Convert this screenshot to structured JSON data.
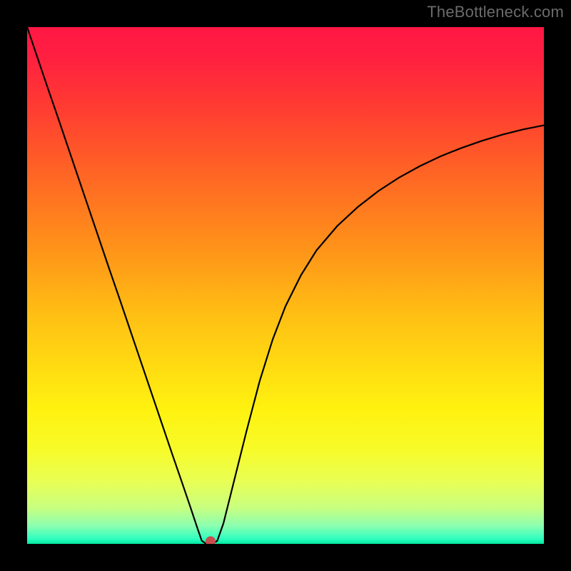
{
  "attribution": "TheBottleneck.com",
  "chart_data": {
    "type": "line",
    "title": "",
    "xlabel": "",
    "ylabel": "",
    "xlim": [
      0,
      100
    ],
    "ylim": [
      0,
      100
    ],
    "grid": false,
    "marker": {
      "x": 35.5,
      "y": 0.5,
      "color": "#c94d4d"
    },
    "gradient_stops": [
      {
        "offset": 0.0,
        "color": "#ff1744"
      },
      {
        "offset": 0.06,
        "color": "#ff2040"
      },
      {
        "offset": 0.15,
        "color": "#ff3a32"
      },
      {
        "offset": 0.25,
        "color": "#ff5a28"
      },
      {
        "offset": 0.35,
        "color": "#ff7a1f"
      },
      {
        "offset": 0.45,
        "color": "#ff9a18"
      },
      {
        "offset": 0.55,
        "color": "#ffbd14"
      },
      {
        "offset": 0.65,
        "color": "#ffd912"
      },
      {
        "offset": 0.74,
        "color": "#fff210"
      },
      {
        "offset": 0.82,
        "color": "#f7fb2a"
      },
      {
        "offset": 0.88,
        "color": "#e8ff55"
      },
      {
        "offset": 0.93,
        "color": "#c8ff80"
      },
      {
        "offset": 0.965,
        "color": "#8cffb0"
      },
      {
        "offset": 0.99,
        "color": "#30ffc0"
      },
      {
        "offset": 1.0,
        "color": "#00e6a0"
      }
    ],
    "series": [
      {
        "name": "bottleneck-curve",
        "x": [
          0.0,
          2.0,
          4.0,
          6.0,
          8.0,
          10.0,
          12.0,
          14.0,
          16.0,
          18.0,
          20.0,
          22.0,
          24.0,
          26.0,
          28.0,
          30.0,
          31.5,
          33.0,
          33.8,
          34.5,
          36.0,
          36.8,
          38.0,
          40.0,
          42.5,
          45.0,
          47.5,
          50.0,
          53.0,
          56.0,
          60.0,
          64.0,
          68.0,
          72.0,
          76.0,
          80.0,
          84.0,
          88.0,
          92.0,
          96.0,
          100.0
        ],
        "y": [
          100.0,
          94.1,
          88.2,
          82.4,
          76.5,
          70.6,
          64.7,
          58.8,
          52.9,
          47.1,
          41.2,
          35.3,
          29.4,
          23.5,
          17.6,
          11.8,
          7.4,
          2.9,
          0.6,
          0.1,
          0.1,
          0.6,
          4.0,
          12.0,
          22.0,
          31.5,
          39.5,
          46.0,
          52.0,
          56.8,
          61.5,
          65.2,
          68.3,
          70.9,
          73.1,
          75.0,
          76.6,
          78.0,
          79.2,
          80.2,
          81.0
        ]
      }
    ]
  }
}
